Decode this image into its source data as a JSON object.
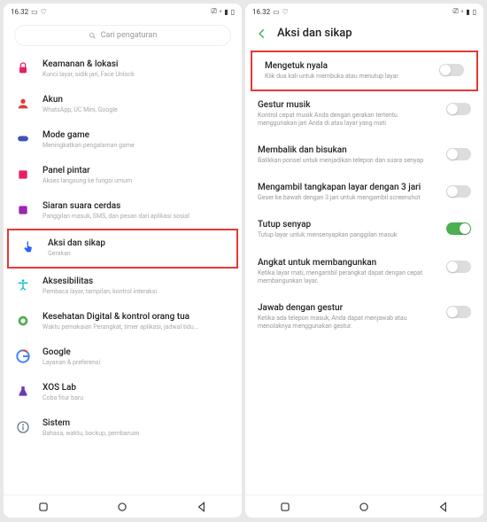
{
  "status": {
    "time": "16.32"
  },
  "left": {
    "search_placeholder": "Cari pengaturan",
    "items": [
      {
        "title": "Keamanan & lokasi",
        "sub": "Kunci layar, sidik jari, Face Unlock",
        "icon": "#e91e63"
      },
      {
        "title": "Akun",
        "sub": "WhatsApp, UC Mini, Google",
        "icon": "#e53935"
      },
      {
        "title": "Mode game",
        "sub": "Meningkatkan pengalaman game",
        "icon": "#3f51b5"
      },
      {
        "title": "Panel pintar",
        "sub": "Akses langsung ke fungsi umum",
        "icon": "#e91e63"
      },
      {
        "title": "Siaran suara cerdas",
        "sub": "Panggilan masuk, SMS, dan pesan dari aplikasi sosial",
        "icon": "#9c27b0"
      },
      {
        "title": "Aksi dan sikap",
        "sub": "Gerakan",
        "icon": "#2962ff"
      },
      {
        "title": "Aksesibilitas",
        "sub": "Pembaca layar, tampilan, kontrol interaksi",
        "icon": "#00bcd4"
      },
      {
        "title": "Kesehatan Digital & kontrol orang tua",
        "sub": "Waktu pemakaian Perangkat, timer aplikasi, jadwal tidu...",
        "icon": "#4caf50"
      },
      {
        "title": "Google",
        "sub": "Layanan & preferensi",
        "icon": "#4285f4"
      },
      {
        "title": "XOS Lab",
        "sub": "Coba fitur baru",
        "icon": "#673ab7"
      },
      {
        "title": "Sistem",
        "sub": "Bahasa, waktu, backup, pembaruan",
        "icon": "#607d8b"
      }
    ]
  },
  "right": {
    "header": "Aksi dan sikap",
    "items": [
      {
        "title": "Mengetuk nyala",
        "sub": "Klik dua kali untuk membuka atau menutup layar",
        "on": false
      },
      {
        "title": "Gestur musik",
        "sub": "Kontrol cepat musik Anda dengan gerakan tertentu menggunakan jari Anda di atas layar yang mati",
        "on": false
      },
      {
        "title": "Membalik dan bisukan",
        "sub": "Balikkan ponsel untuk menjadikan telepon dan suara senyap",
        "on": false
      },
      {
        "title": "Mengambil tangkapan layar dengan 3 jari",
        "sub": "Geser ke bawah dengan 3 jari untuk mengambil screenshot",
        "on": false
      },
      {
        "title": "Tutup senyap",
        "sub": "Tutup layar untuk mensenyapkan panggilan masuk",
        "on": true
      },
      {
        "title": "Angkat untuk membangunkan",
        "sub": "Ketika layar mati, mengambil perangkat dapat dengan cepat membangunkan layar.",
        "on": false
      },
      {
        "title": "Jawab dengan gestur",
        "sub": "Ketika ada telepon masuk, Anda dapat menjawab atau menolaknya menggunakan gestur.",
        "on": false
      }
    ]
  }
}
